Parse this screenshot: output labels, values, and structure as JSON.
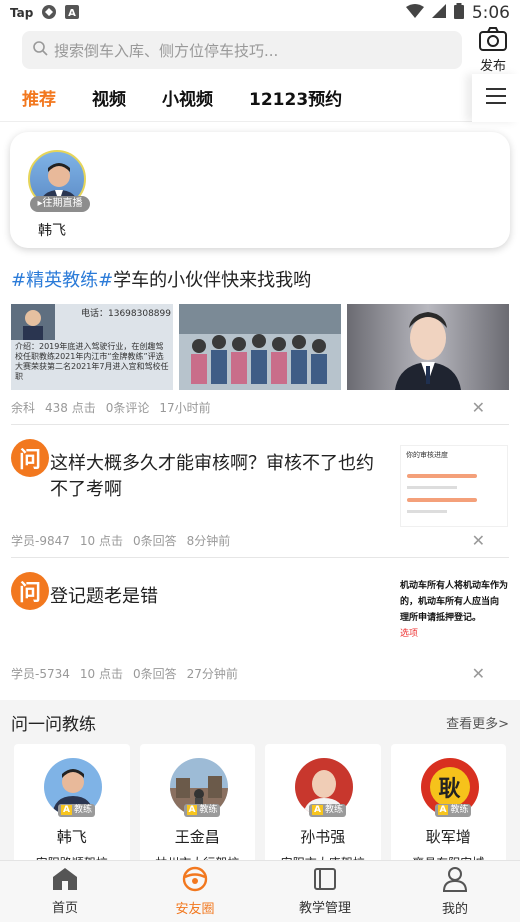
{
  "status_bar": {
    "carrier": "Tap",
    "time": "5:06"
  },
  "search": {
    "placeholder": "搜索倒车入库、侧方位停车技巧..."
  },
  "publish_label": "发布",
  "tabs": [
    {
      "label": "推荐",
      "active": true
    },
    {
      "label": "视频"
    },
    {
      "label": "小视频"
    },
    {
      "label": "12123预约"
    }
  ],
  "live": {
    "tag": "往期直播",
    "name": "韩飞"
  },
  "post1": {
    "hashtag": "#精英教练#",
    "title_rest": "学车的小伙伴快来找我哟",
    "image_text_phone": "电话：13698308899",
    "image_text_body": "介绍：2019年底进入驾驶行业，在创趣驾校任职教练2021年内江市“金牌教练”评选大赛荣获第二名2021年7月进入宜和驾校任职",
    "author": "余科",
    "clicks": "438 点击",
    "comments": "0条评论",
    "time": "17小时前"
  },
  "qa1": {
    "icon": "问",
    "text": "这样大概多久才能审核啊？审核不了也约不了考啊",
    "thumb_title": "你的审核进度",
    "author": "学员-9847",
    "clicks": "10 点击",
    "answers": "0条回答",
    "time": "8分钟前"
  },
  "qa2": {
    "icon": "问",
    "text": "登记题老是错",
    "thumb_lines": [
      "机动车所有人将机动车作为",
      "的，机动车所有人应当向",
      "理所申请抵押登记。"
    ],
    "thumb_wrong": "选项",
    "author": "学员-5734",
    "clicks": "10 点击",
    "answers": "0条回答",
    "time": "27分钟前"
  },
  "ask": {
    "title": "问一问教练",
    "more": "查看更多>",
    "coaches": [
      {
        "name": "韩飞",
        "school": "安阳路顺驾校",
        "badge": "教练"
      },
      {
        "name": "王金昌",
        "school": "林州市大行驾校",
        "badge": "教练"
      },
      {
        "name": "孙书强",
        "school": "安阳市大唐驾校",
        "badge": "教练"
      },
      {
        "name": "耿军增",
        "school": "襄县东阳安城",
        "badge": "教练",
        "avatar_char": "耿"
      }
    ]
  },
  "nav": [
    {
      "label": "首页"
    },
    {
      "label": "安友圈",
      "active": true
    },
    {
      "label": "教学管理"
    },
    {
      "label": "我的"
    }
  ],
  "colors": {
    "accent": "#f2781f",
    "hashtag": "#2b7bd8"
  }
}
